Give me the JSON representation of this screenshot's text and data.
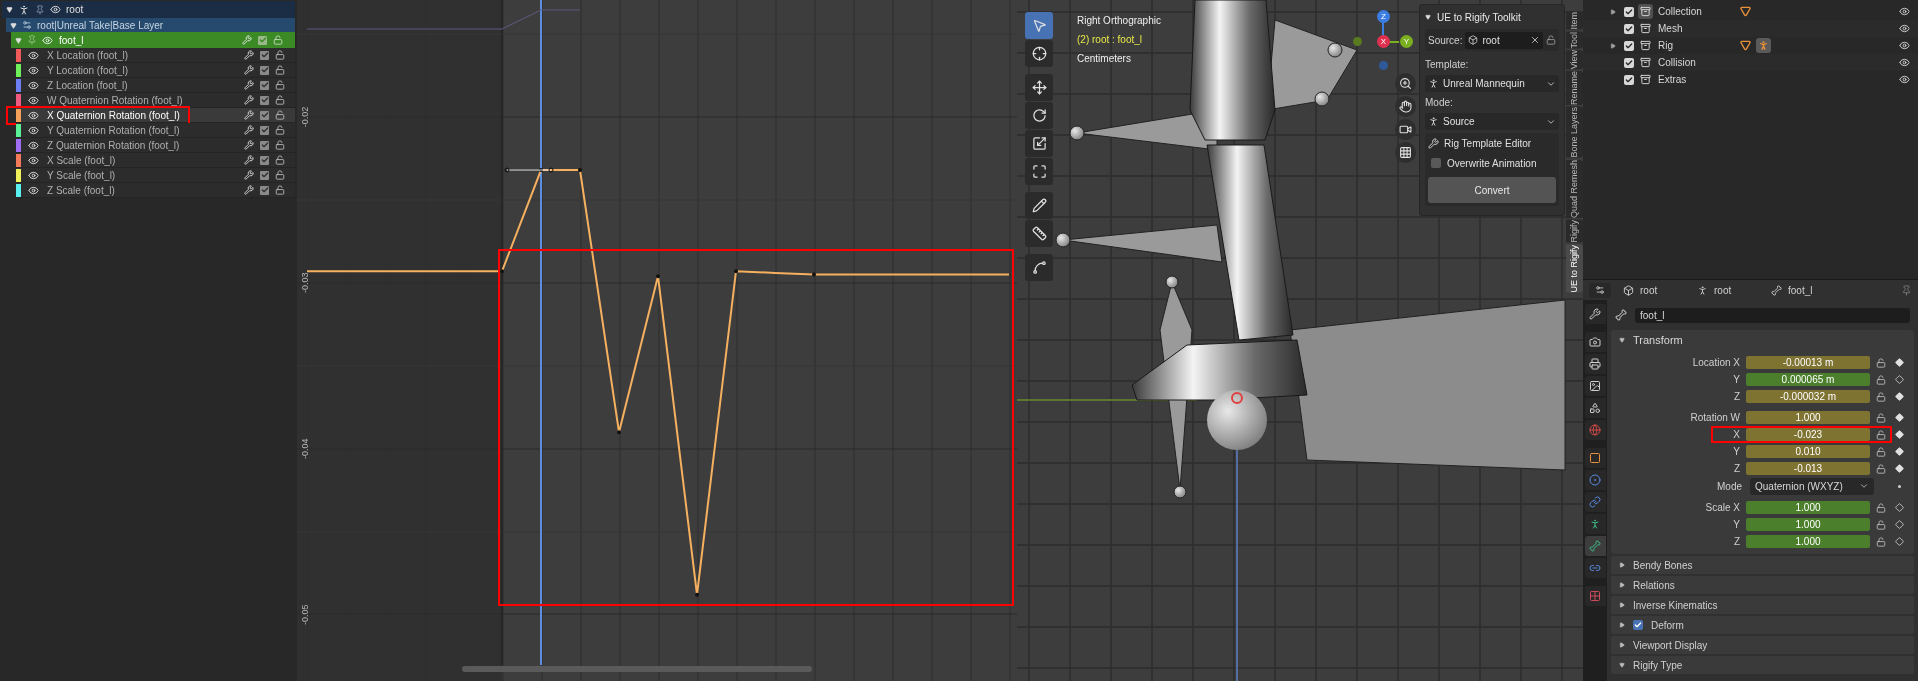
{
  "channel_list": {
    "object": {
      "name": "root"
    },
    "action": {
      "name": "root|Unreal Take|Base Layer"
    },
    "group": {
      "name": "foot_l",
      "enabled": true
    },
    "channels": [
      {
        "name": "X Location (foot_l)",
        "color": "#f05a5a",
        "selected": false,
        "enabled": true,
        "highlighted": false
      },
      {
        "name": "Y Location (foot_l)",
        "color": "#6ef05a",
        "selected": false,
        "enabled": true,
        "highlighted": false
      },
      {
        "name": "Z Location (foot_l)",
        "color": "#6e7ff5",
        "selected": false,
        "enabled": true,
        "highlighted": false
      },
      {
        "name": "W Quaternion Rotation (foot_l)",
        "color": "#f05a80",
        "selected": false,
        "enabled": true,
        "highlighted": false
      },
      {
        "name": "X Quaternion Rotation (foot_l)",
        "color": "#f5a05a",
        "selected": true,
        "enabled": true,
        "highlighted": true
      },
      {
        "name": "Y Quaternion Rotation (foot_l)",
        "color": "#5af096",
        "selected": false,
        "enabled": true,
        "highlighted": false
      },
      {
        "name": "Z Quaternion Rotation (foot_l)",
        "color": "#a06ef5",
        "selected": false,
        "enabled": true,
        "highlighted": false
      },
      {
        "name": "X Scale (foot_l)",
        "color": "#f57a5a",
        "selected": false,
        "enabled": true,
        "highlighted": false
      },
      {
        "name": "Y Scale (foot_l)",
        "color": "#f0f05a",
        "selected": false,
        "enabled": true,
        "highlighted": false
      },
      {
        "name": "Z Scale (foot_l)",
        "color": "#5af0f0",
        "selected": false,
        "enabled": true,
        "highlighted": false
      }
    ]
  },
  "graph": {
    "highlighted": true,
    "chart_data": {
      "type": "line",
      "grid": true,
      "categories": [
        null,
        null,
        null,
        null,
        null,
        null,
        null,
        null,
        null,
        null,
        null,
        null,
        null,
        null,
        null,
        null,
        null,
        null,
        null
      ],
      "ylim": [
        -0.054,
        -0.01295
      ],
      "yticks": [
        {
          "value": -0.02,
          "label": "-0.02"
        },
        {
          "value": -0.03,
          "label": "-0.03"
        },
        {
          "value": -0.04,
          "label": "-0.04"
        },
        {
          "value": -0.05,
          "label": "-0.05"
        }
      ],
      "series": [
        {
          "color": "#f5b060",
          "values": [
            -0.0293,
            -0.0293,
            -0.0293,
            -0.0293,
            -0.0293,
            -0.0293,
            -0.0232,
            -0.0232,
            -0.039,
            -0.0296,
            -0.0488,
            -0.0293,
            -0.0294,
            -0.0295,
            -0.0295,
            -0.0295,
            -0.0295,
            -0.0295,
            -0.0295
          ]
        },
        {
          "color": "#5a5a80",
          "values": [
            -0.0147,
            -0.0147,
            -0.0147,
            -0.0147,
            -0.0147,
            -0.0147,
            -0.01355,
            -0.01355,
            null,
            null,
            null,
            null,
            null,
            null,
            null,
            null,
            null,
            null,
            null
          ]
        }
      ]
    }
  },
  "viewport": {
    "view": "Right Orthographic",
    "active_object": "(2) root : foot_l",
    "units": "Centimeters",
    "tools": [
      {
        "kind": "select",
        "selected": true
      },
      {
        "kind": "cursor",
        "selected": false
      },
      {
        "kind": "move",
        "selected": false
      },
      {
        "kind": "rotate",
        "selected": false
      },
      {
        "kind": "scale",
        "selected": false
      },
      {
        "kind": "transform",
        "selected": false
      },
      {
        "kind": "annotate",
        "selected": false
      },
      {
        "kind": "measure",
        "selected": false
      },
      {
        "kind": "curve",
        "selected": false
      }
    ],
    "gizmo": {
      "z": "Z",
      "x": "X",
      "y": "Y"
    },
    "nav": [
      {
        "kind": "zoom"
      },
      {
        "kind": "pan"
      },
      {
        "kind": "camera"
      },
      {
        "kind": "grid"
      }
    ]
  },
  "toolkit": {
    "title": "UE to Rigify Toolkit",
    "source_label": "Source:",
    "source_value": "root",
    "template_label": "Template:",
    "template_value": "Unreal Mannequin",
    "mode_label": "Mode:",
    "mode_value": "Source",
    "editor_label": "Rig Template Editor",
    "overwrite": {
      "label": "Overwrite Animation",
      "checked": false
    },
    "convert": "Convert"
  },
  "sidebar_tabs": [
    {
      "label": "Item",
      "selected": false
    },
    {
      "label": "Tool",
      "selected": false
    },
    {
      "label": "View",
      "selected": false
    },
    {
      "label": "Rename",
      "selected": false
    },
    {
      "label": "Bone Layers",
      "selected": false
    },
    {
      "label": "Quad Remesh",
      "selected": false
    },
    {
      "label": "Rigify",
      "selected": false
    },
    {
      "label": "UE to Rigify",
      "selected": true
    }
  ],
  "outliner": {
    "rows": [
      {
        "name": "Collection",
        "expandable": true,
        "checked": true,
        "active": true,
        "objects": [
          {
            "kind": "mesh",
            "active": false
          }
        ]
      },
      {
        "name": "Mesh",
        "expandable": false,
        "checked": true,
        "active": false
      },
      {
        "name": "Rig",
        "expandable": true,
        "checked": true,
        "active": false,
        "objects": [
          {
            "kind": "mesh",
            "active": false
          },
          {
            "kind": "armature",
            "active": true
          }
        ]
      },
      {
        "name": "Collision",
        "expandable": false,
        "checked": true,
        "active": false
      },
      {
        "name": "Extras",
        "expandable": false,
        "checked": true,
        "active": false
      }
    ]
  },
  "properties": {
    "breadcrumb": [
      {
        "kind": "object",
        "label": "root"
      },
      {
        "kind": "armature",
        "label": "root"
      },
      {
        "kind": "bone",
        "label": "foot_l"
      }
    ],
    "tabs": [
      {
        "kind": "tool",
        "selected": false
      },
      {
        "kind": "render",
        "selected": false
      },
      {
        "kind": "output",
        "selected": false
      },
      {
        "kind": "view_layer",
        "selected": false
      },
      {
        "kind": "scene",
        "selected": false
      },
      {
        "kind": "world",
        "selected": false
      },
      {
        "kind": "object",
        "selected": false
      },
      {
        "kind": "physics",
        "selected": false
      },
      {
        "kind": "constraint",
        "selected": false
      },
      {
        "kind": "data",
        "selected": false
      },
      {
        "kind": "bone",
        "selected": true
      },
      {
        "kind": "bone_constraint",
        "selected": false
      },
      {
        "kind": "texture",
        "selected": false
      }
    ],
    "bone_name": "foot_l",
    "transform": {
      "title": "Transform",
      "expanded": true,
      "groups": [
        [
          {
            "kind": "field",
            "label": "Location X",
            "value": "-0.00013 m",
            "keyed": true,
            "highlighted": false
          },
          {
            "kind": "field",
            "label": "Y",
            "value": "0.000065 m",
            "keyed": false,
            "highlighted": false
          },
          {
            "kind": "field",
            "label": "Z",
            "value": "-0.000032 m",
            "keyed": true,
            "highlighted": false
          }
        ],
        [
          {
            "kind": "field",
            "label": "Rotation W",
            "value": "1.000",
            "keyed": true,
            "highlighted": false
          },
          {
            "kind": "field",
            "label": "X",
            "value": "-0.023",
            "keyed": true,
            "highlighted": true
          },
          {
            "kind": "field",
            "label": "Y",
            "value": "0.010",
            "keyed": true,
            "highlighted": false
          },
          {
            "kind": "field",
            "label": "Z",
            "value": "-0.013",
            "keyed": true,
            "highlighted": false
          },
          {
            "kind": "dropdown",
            "label": "Mode",
            "value": "Quaternion (WXYZ)"
          }
        ],
        [
          {
            "kind": "field",
            "label": "Scale X",
            "value": "1.000",
            "keyed": false,
            "highlighted": false
          },
          {
            "kind": "field",
            "label": "Y",
            "value": "1.000",
            "keyed": false,
            "highlighted": false
          },
          {
            "kind": "field",
            "label": "Z",
            "value": "1.000",
            "keyed": false,
            "highlighted": false
          }
        ]
      ]
    },
    "panels": [
      {
        "title": "Bendy Bones",
        "expanded": false
      },
      {
        "title": "Relations",
        "expanded": false
      },
      {
        "title": "Inverse Kinematics",
        "expanded": false
      },
      {
        "title": "Deform",
        "expanded": false,
        "checkbox": {
          "checked": true
        }
      },
      {
        "title": "Viewport Display",
        "expanded": false
      },
      {
        "title": "Rigify Type",
        "expanded": true
      }
    ]
  }
}
